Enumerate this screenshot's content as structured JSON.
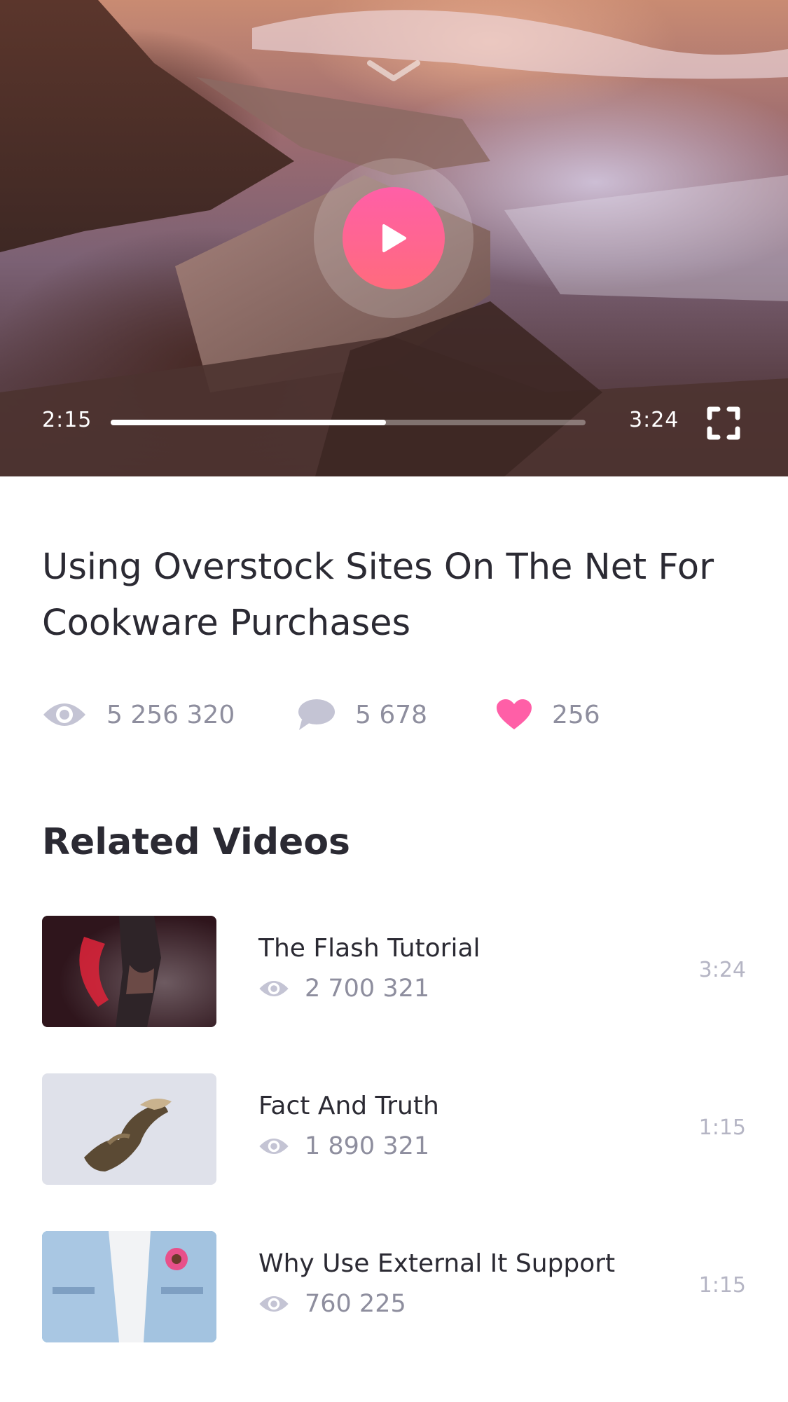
{
  "player": {
    "current_time": "2:15",
    "total_time": "3:24",
    "progress_fraction": 0.58,
    "state": "paused",
    "collapse_icon": "chevron-down-icon",
    "play_icon": "play-icon",
    "fullscreen_icon": "fullscreen-icon"
  },
  "video": {
    "title": "Using Overstock Sites On The Net For Cookware Purchases",
    "views": "5 256 320",
    "comments": "5 678",
    "likes": "256"
  },
  "related": {
    "heading": "Related Videos",
    "items": [
      {
        "title": "The Flash Tutorial",
        "views": "2 700 321",
        "duration": "3:24",
        "thumb": "dancer-in-smoke"
      },
      {
        "title": "Fact And Truth",
        "views": "1 890 321",
        "duration": "1:15",
        "thumb": "eagle-in-flight"
      },
      {
        "title": "Why Use External It Support",
        "views": "760 225",
        "duration": "1:15",
        "thumb": "denim-jacket"
      }
    ]
  },
  "colors": {
    "accent_pink": "#ff5fa7",
    "icon_gray": "#c4c4d4",
    "text_dark": "#2b2a33",
    "text_muted": "#8e8e9e"
  }
}
